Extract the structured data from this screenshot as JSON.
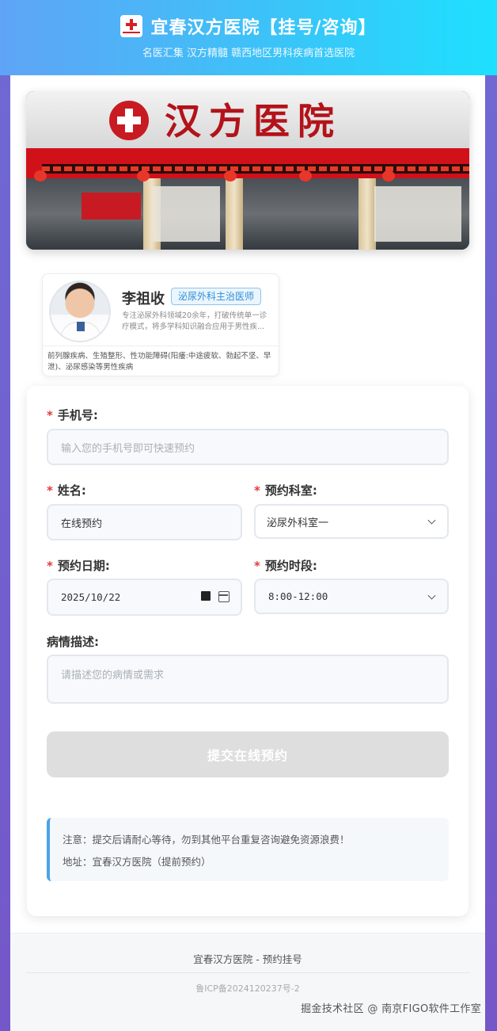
{
  "header": {
    "title": "宜春汉方医院【挂号/咨询】",
    "subtitle": "名医汇集 汉方精髓 赣西地区男科疾病首选医院"
  },
  "banner": {
    "sign_text": "汉方医院"
  },
  "doctor": {
    "name": "李祖收",
    "badge": "泌尿外科主治医师",
    "intro": "专注泌尿外科领域20余年，打破传统单一诊疗模式，将多学科知识融合应用于男性疾...",
    "skills": "前列腺疾病、生殖整形、性功能障碍(阳痿:中途疲软、勃起不坚、早泄)、泌尿感染等男性疾病"
  },
  "form": {
    "phone": {
      "label": "手机号:",
      "placeholder": "输入您的手机号即可快速预约"
    },
    "name": {
      "label": "姓名:",
      "value": "在线预约"
    },
    "department": {
      "label": "预约科室:",
      "value": "泌尿外科室一"
    },
    "date": {
      "label": "预约日期:",
      "value": "2025/10/22"
    },
    "time": {
      "label": "预约时段:",
      "value": "8:00-12:00"
    },
    "description": {
      "label": "病情描述:",
      "placeholder": "请描述您的病情或需求"
    },
    "submit_label": "提交在线预约",
    "required_mark": "*"
  },
  "notice": {
    "line1": "注意：提交后请耐心等待，勿到其他平台重复咨询避免资源浪费！",
    "line2": "地址：宜春汉方医院（提前预约）"
  },
  "footer": {
    "title": "宜春汉方医院 - 预约挂号",
    "icp": "鲁ICP备2024120237号-2"
  },
  "watermark": "掘金技术社区 @ 南京FIGO软件工作室",
  "colors": {
    "header_start": "#5fa4f6",
    "header_end": "#1ee0ff",
    "required": "#e03b3b",
    "badge": "#2f8fd8",
    "notice_accent": "#4aa3e6",
    "submit_disabled": "#dedede"
  }
}
